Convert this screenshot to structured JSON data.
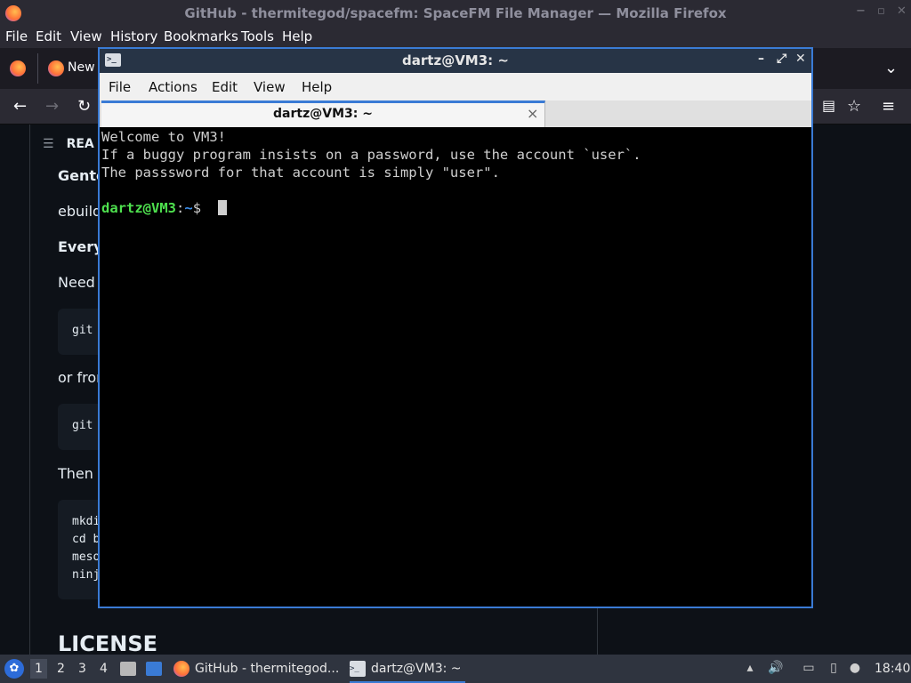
{
  "firefox": {
    "window_title": "GitHub - thermitegod/spacefm: SpaceFM File Manager — Mozilla Firefox",
    "window_controls": [
      "−",
      "▫",
      "✕"
    ],
    "menu": [
      "File",
      "Edit",
      "View",
      "History",
      "Bookmarks",
      "Tools",
      "Help"
    ],
    "tab_label": "New",
    "nav_icons": [
      "back-icon",
      "forward-icon",
      "reload-icon",
      "reader-icon",
      "bookmark-star-icon",
      "menu-icon"
    ]
  },
  "page": {
    "readme_heading": "REA",
    "lines": [
      "Gento",
      "ebuild",
      "Everyo",
      "Need t",
      "or from",
      "Then b"
    ],
    "code1": "git",
    "code2": "git",
    "code3": [
      "mkdi",
      "cd b",
      "meso",
      "ninj"
    ],
    "license": "LICENSE"
  },
  "terminal": {
    "window_title": "dartz@VM3: ~",
    "menu": [
      "File",
      "Actions",
      "Edit",
      "View",
      "Help"
    ],
    "tab_title": "dartz@VM3: ~",
    "tab_close": "×",
    "output": [
      "Welcome to VM3!",
      "If a buggy program insists on a password, use the account `user`.",
      "The passsword for that account is simply \"user\"."
    ],
    "prompt_user": "dartz@VM3",
    "prompt_colon": ":",
    "prompt_path": "~",
    "prompt_symbol": "$",
    "colors": {
      "user": "#4ee04e",
      "path": "#3b8eea",
      "accent": "#3a7bd5"
    }
  },
  "taskbar": {
    "workspaces": [
      "1",
      "2",
      "3",
      "4"
    ],
    "tasks": [
      {
        "label": "GitHub - thermitegod...",
        "icon": "firefox-icon"
      },
      {
        "label": "dartz@VM3: ~",
        "icon": "terminal-icon"
      }
    ],
    "clock": "18:40"
  }
}
